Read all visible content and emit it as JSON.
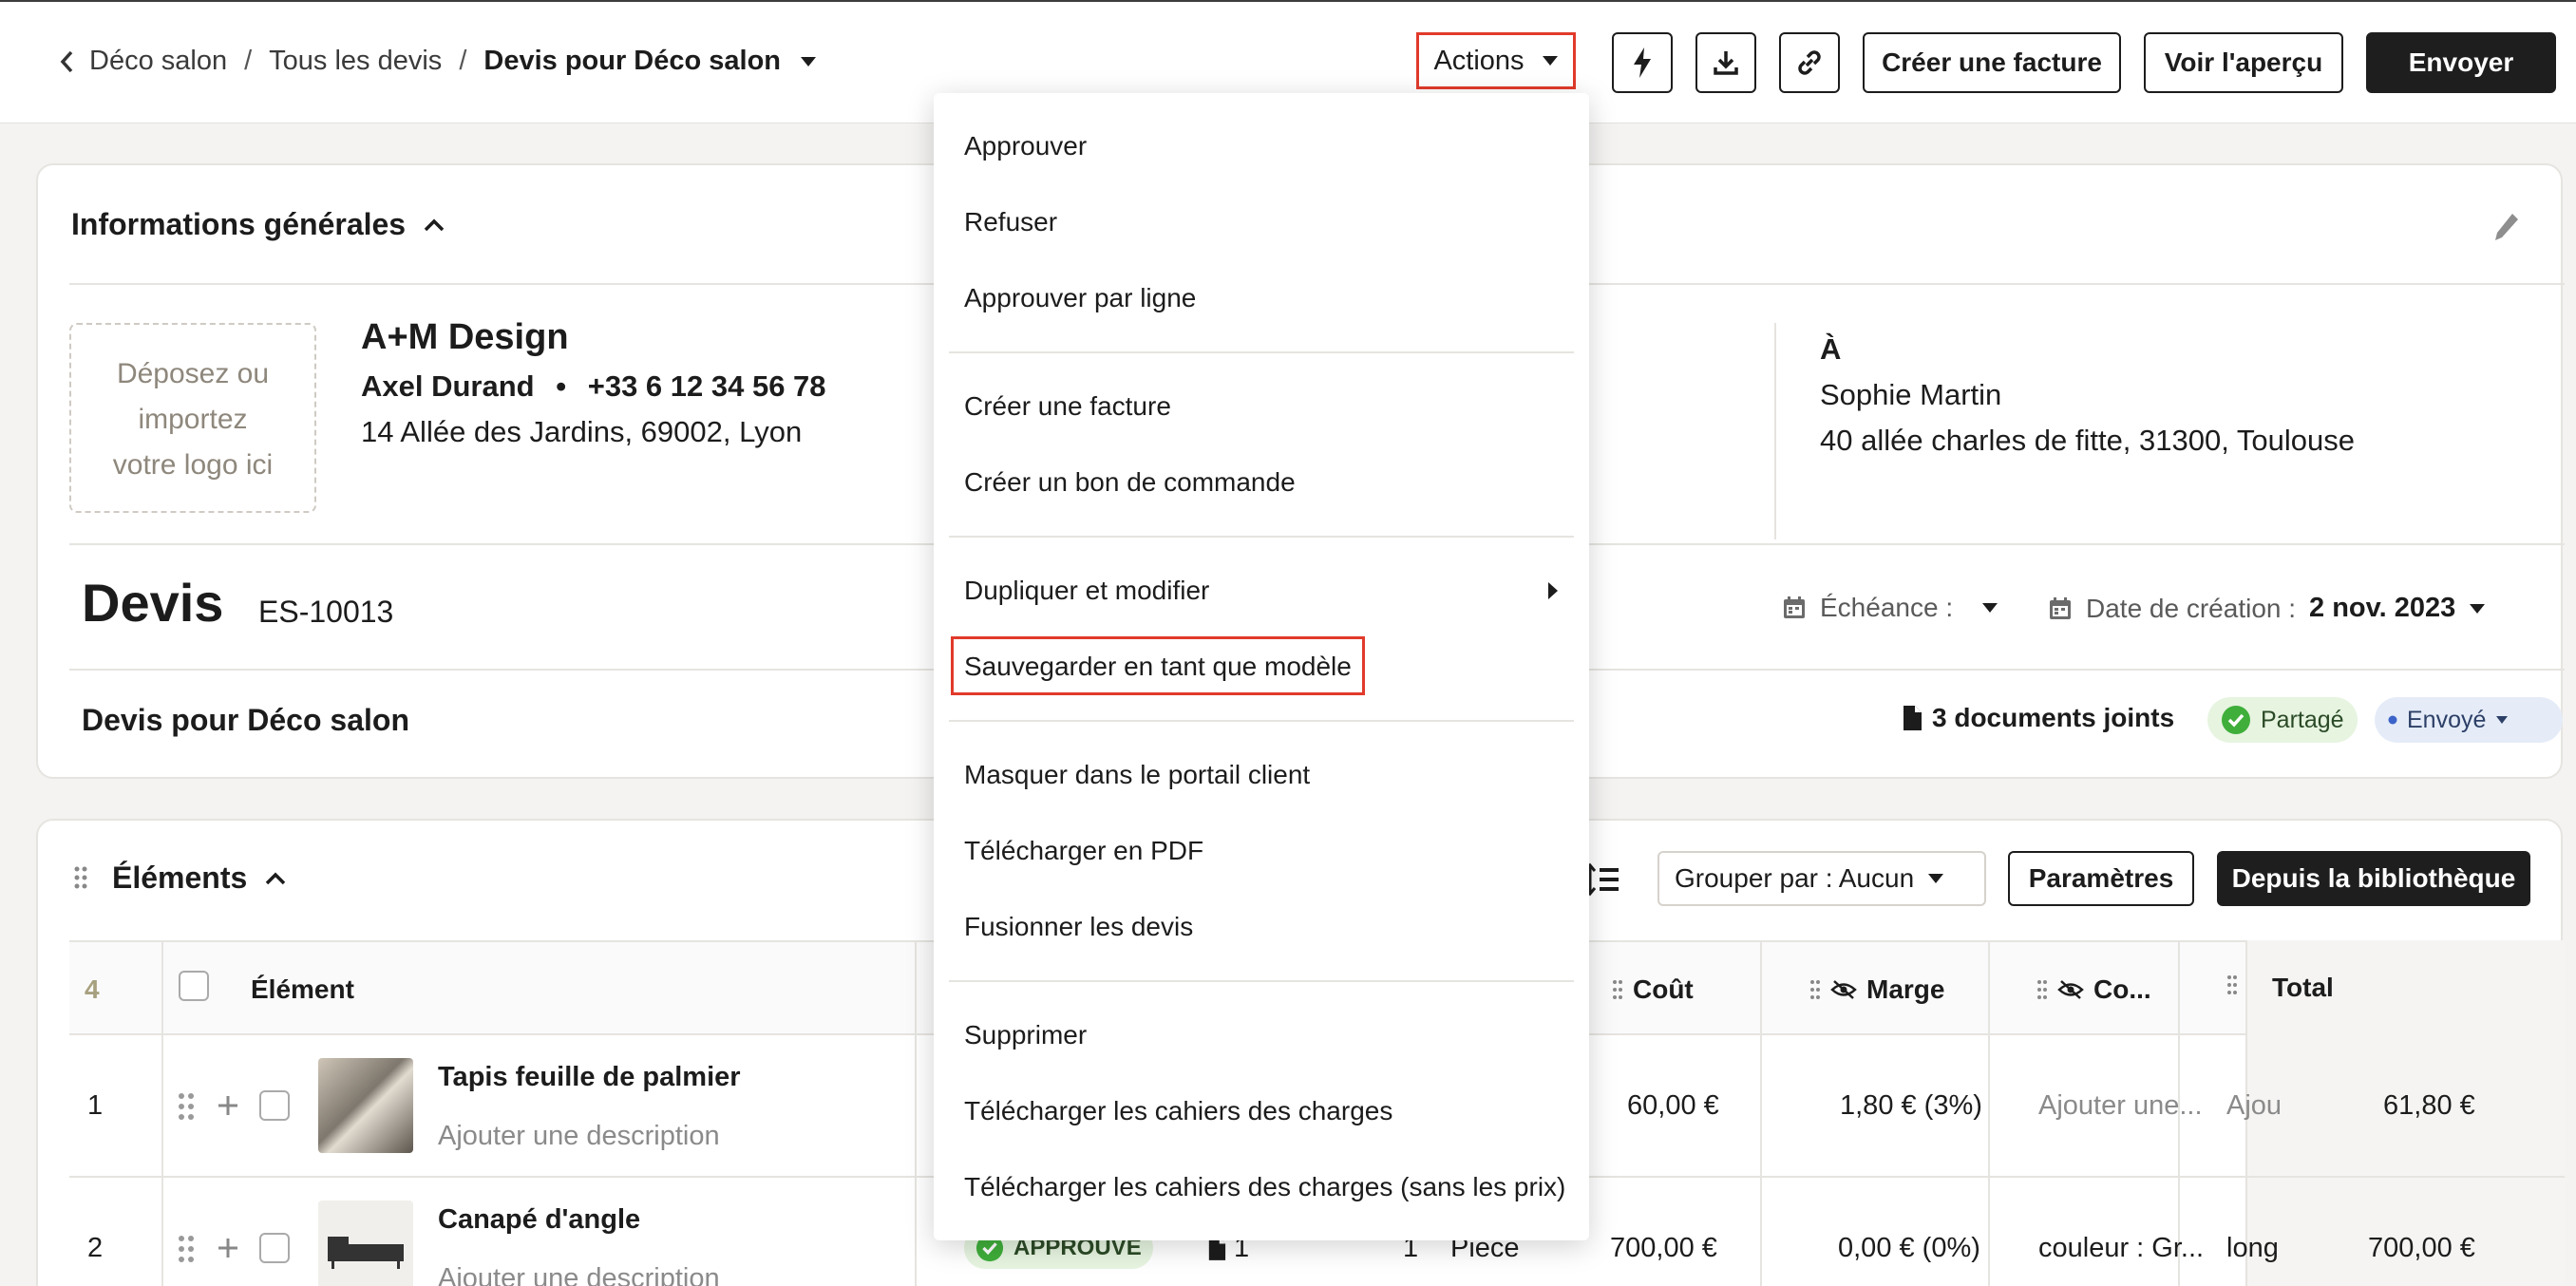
{
  "breadcrumb": {
    "items": [
      "Déco salon",
      "Tous les devis",
      "Devis pour Déco salon"
    ],
    "separator": "/"
  },
  "toolbar": {
    "actions_label": "Actions",
    "create_invoice_label": "Créer une facture",
    "preview_label": "Voir l'aperçu",
    "send_label": "Envoyer",
    "icons": [
      "bolt-icon",
      "download-icon",
      "link-icon"
    ]
  },
  "general_info": {
    "title": "Informations générales",
    "logo_drop": [
      "Déposez ou",
      "importez",
      "votre logo ici"
    ],
    "company": {
      "name": "A+M Design",
      "contact": "Axel Durand",
      "bullet": "•",
      "phone": "+33 6 12 34 56 78",
      "address": "14 Allée des Jardins, 69002, Lyon"
    },
    "recipient": {
      "to_label": "À",
      "name": "Sophie Martin",
      "address": "40 allée charles de fitte, 31300, Toulouse"
    },
    "devis_label": "Devis",
    "devis_number": "ES-10013",
    "due_label": "Échéance :",
    "creation_label": "Date de création :",
    "creation_date": "2 nov. 2023",
    "subject": "Devis pour Déco salon",
    "documents": "3 documents joints",
    "shared_badge": "Partagé",
    "sent_badge": "Envoyé"
  },
  "elements": {
    "title": "Éléments",
    "group_by": "Grouper par : Aucun",
    "params_label": "Paramètres",
    "library_label": "Depuis la bibliothèque",
    "count": "4",
    "columns": {
      "element": "Élément",
      "cost": "Coût",
      "margin": "Marge",
      "comment": "Co...",
      "total": "Total"
    },
    "rows": [
      {
        "index": "1",
        "name": "Tapis feuille de palmier",
        "description": "Ajouter une description",
        "cost": "60,00 €",
        "margin": "1,80 € (3%)",
        "comment": "Ajouter une...",
        "extra": "Ajou",
        "total": "61,80 €"
      },
      {
        "index": "2",
        "name": "Canapé d'angle",
        "description": "Ajouter une description",
        "status": "APPROUVE",
        "docs": "1",
        "qty": "1",
        "unit": "Pièce",
        "cost": "700,00 €",
        "margin": "0,00 € (0%)",
        "comment": "couleur : Gr...",
        "extra": "long",
        "total": "700,00 €"
      }
    ]
  },
  "menu": {
    "items": [
      "Approuver",
      "Refuser",
      "Approuver par ligne",
      "Créer une facture",
      "Créer un bon de commande",
      "Dupliquer et modifier",
      "Sauvegarder en tant que modèle",
      "Masquer dans le portail client",
      "Télécharger en PDF",
      "Fusionner les devis",
      "Supprimer",
      "Télécharger les cahiers des charges",
      "Télécharger les cahiers des charges (sans les prix)"
    ],
    "highlighted": "Sauvegarder en tant que modèle"
  },
  "colors": {
    "highlight_border": "#e13a2b",
    "primary_dark": "#1e1e1e",
    "success_green": "#3fae3a",
    "sent_blue": "#3b63c9"
  }
}
